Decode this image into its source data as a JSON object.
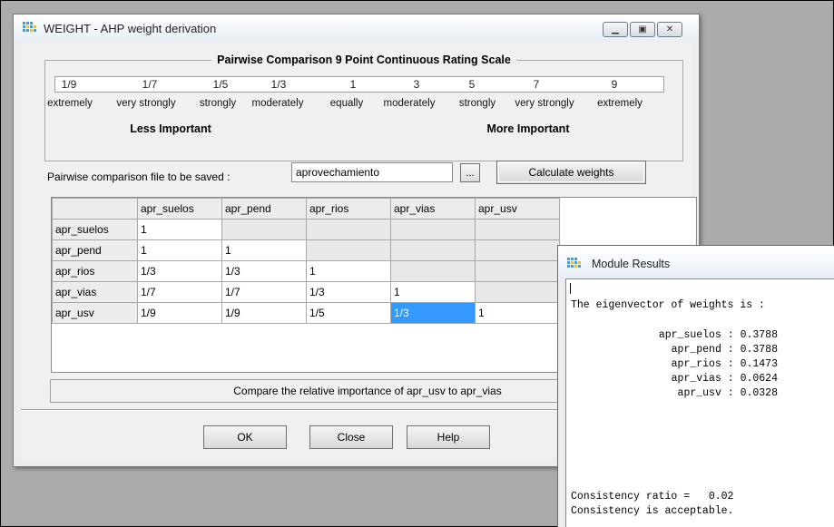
{
  "main_window": {
    "title": "WEIGHT - AHP weight derivation",
    "window_buttons": [
      "minimize",
      "maximize",
      "close"
    ]
  },
  "scale": {
    "title": "Pairwise Comparison 9 Point Continuous Rating Scale",
    "values": [
      "1/9",
      "1/7",
      "1/5",
      "1/3",
      "1",
      "3",
      "5",
      "7",
      "9"
    ],
    "words": [
      "extremely",
      "very strongly",
      "strongly",
      "moderately",
      "equally",
      "moderately",
      "strongly",
      "very strongly",
      "extremely"
    ],
    "less_label": "Less Important",
    "more_label": "More Important"
  },
  "file": {
    "label": "Pairwise comparison file to be saved :",
    "value": "aprovechamiento",
    "browse_label": "...",
    "calculate_label": "Calculate weights"
  },
  "matrix": {
    "columns": [
      "apr_suelos",
      "apr_pend",
      "apr_rios",
      "apr_vias",
      "apr_usv"
    ],
    "rows": [
      {
        "name": "apr_suelos",
        "cells": [
          "1",
          "",
          "",
          "",
          ""
        ]
      },
      {
        "name": "apr_pend",
        "cells": [
          "1",
          "1",
          "",
          "",
          ""
        ]
      },
      {
        "name": "apr_rios",
        "cells": [
          "1/3",
          "1/3",
          "1",
          "",
          ""
        ]
      },
      {
        "name": "apr_vias",
        "cells": [
          "1/7",
          "1/7",
          "1/3",
          "1",
          ""
        ]
      },
      {
        "name": "apr_usv",
        "cells": [
          "1/9",
          "1/9",
          "1/5",
          "1/3",
          "1"
        ]
      }
    ],
    "selected": {
      "row": 4,
      "col": 3
    }
  },
  "status_text": "Compare the relative importance of apr_usv to apr_vias",
  "buttons": {
    "ok": "OK",
    "close": "Close",
    "help": "Help"
  },
  "results_window": {
    "title": "Module Results",
    "header": "The eigenvector of weights is :",
    "weights": [
      {
        "name": "apr_suelos",
        "value": "0.3788"
      },
      {
        "name": "apr_pend",
        "value": "0.3788"
      },
      {
        "name": "apr_rios",
        "value": "0.1473"
      },
      {
        "name": "apr_vias",
        "value": "0.0624"
      },
      {
        "name": "apr_usv",
        "value": "0.0328"
      }
    ],
    "consistency_ratio_label": "Consistency ratio =",
    "consistency_ratio_value": "0.02",
    "consistency_message": "Consistency is acceptable."
  }
}
